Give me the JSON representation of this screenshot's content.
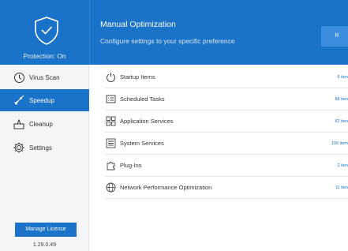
{
  "protection": {
    "status": "Protection: On"
  },
  "header": {
    "title": "Manual Optimization",
    "subtitle": "Configure settings to your specific preference",
    "button_label": "R"
  },
  "sidebar": {
    "items": [
      {
        "label": "Virus Scan",
        "icon": "virus-scan-icon",
        "active": false
      },
      {
        "label": "Speedup",
        "icon": "rocket-icon",
        "active": true
      },
      {
        "label": "Cleanup",
        "icon": "cleanup-icon",
        "active": false
      },
      {
        "label": "Settings",
        "icon": "gear-icon",
        "active": false
      }
    ],
    "license_button": "Manage License",
    "version": "1.29.0.49"
  },
  "items": [
    {
      "label": "Startup Items",
      "count": "6 iten",
      "icon": "power-icon"
    },
    {
      "label": "Scheduled Tasks",
      "count": "88 iten",
      "icon": "tasks-icon"
    },
    {
      "label": "Application Services",
      "count": "82 iten",
      "icon": "grid-icon"
    },
    {
      "label": "System Services",
      "count": "156 item",
      "icon": "list-icon"
    },
    {
      "label": "Plug-Ins",
      "count": "2 iten",
      "icon": "puzzle-icon"
    },
    {
      "label": "Network Performance Optimization",
      "count": "11 iten",
      "icon": "globe-icon"
    }
  ],
  "colors": {
    "accent": "#1a73c8",
    "sidebar_bg": "#f3f5f8"
  }
}
